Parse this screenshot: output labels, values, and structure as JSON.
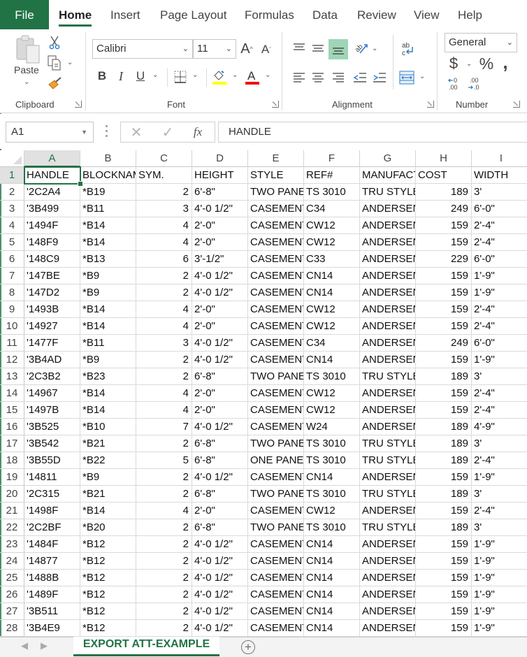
{
  "app": {
    "accent_color": "#217346"
  },
  "ribbon_tabs": [
    {
      "label": "File"
    },
    {
      "label": "Home"
    },
    {
      "label": "Insert"
    },
    {
      "label": "Page Layout"
    },
    {
      "label": "Formulas"
    },
    {
      "label": "Data"
    },
    {
      "label": "Review"
    },
    {
      "label": "View"
    },
    {
      "label": "Help"
    }
  ],
  "ribbon": {
    "clipboard": {
      "label": "Clipboard",
      "paste_label": "Paste"
    },
    "font": {
      "label": "Font",
      "font_name": "Calibri",
      "font_size": "11",
      "bold": "B",
      "italic": "I",
      "underline": "U",
      "fill_color": "#ffff00",
      "font_color": "#ff0000"
    },
    "alignment": {
      "label": "Alignment"
    },
    "number": {
      "label": "Number",
      "format": "General",
      "currency_symbol": "$",
      "percent_symbol": "%",
      "comma_symbol": ","
    }
  },
  "formula_bar": {
    "name_box": "A1",
    "fx_label": "fx",
    "content": "HANDLE"
  },
  "sheet": {
    "columns": [
      "A",
      "B",
      "C",
      "D",
      "E",
      "F",
      "G",
      "H",
      "I"
    ],
    "active_cell": "A1",
    "rows": [
      {
        "n": "1",
        "cells": [
          "HANDLE",
          "BLOCKNAME",
          "SYM.",
          "HEIGHT",
          "STYLE",
          "REF#",
          "MANUFACTURER",
          "COST",
          "WIDTH"
        ]
      },
      {
        "n": "2",
        "cells": [
          "'2C2A4",
          "*B19",
          "2",
          "6'-8\"",
          "TWO PANEL",
          "TS 3010",
          "TRU STYLE",
          "189",
          "3'"
        ]
      },
      {
        "n": "3",
        "cells": [
          "'3B499",
          "*B11",
          "3",
          "4'-0 1/2\"",
          "CASEMENT",
          "C34",
          "ANDERSEN",
          "249",
          "6'-0\""
        ]
      },
      {
        "n": "4",
        "cells": [
          "'1494F",
          "*B14",
          "4",
          "2'-0\"",
          "CASEMENT",
          "CW12",
          "ANDERSEN",
          "159",
          "2'-4\""
        ]
      },
      {
        "n": "5",
        "cells": [
          "'148F9",
          "*B14",
          "4",
          "2'-0\"",
          "CASEMENT",
          "CW12",
          "ANDERSEN",
          "159",
          "2'-4\""
        ]
      },
      {
        "n": "6",
        "cells": [
          "'148C9",
          "*B13",
          "6",
          "3'-1/2\"",
          "CASEMENT",
          "C33",
          "ANDERSEN",
          "229",
          "6'-0\""
        ]
      },
      {
        "n": "7",
        "cells": [
          "'147BE",
          "*B9",
          "2",
          "4'-0 1/2\"",
          "CASEMENT",
          "CN14",
          "ANDERSEN",
          "159",
          "1'-9\""
        ]
      },
      {
        "n": "8",
        "cells": [
          "'147D2",
          "*B9",
          "2",
          "4'-0 1/2\"",
          "CASEMENT",
          "CN14",
          "ANDERSEN",
          "159",
          "1'-9\""
        ]
      },
      {
        "n": "9",
        "cells": [
          "'1493B",
          "*B14",
          "4",
          "2'-0\"",
          "CASEMENT",
          "CW12",
          "ANDERSEN",
          "159",
          "2'-4\""
        ]
      },
      {
        "n": "10",
        "cells": [
          "'14927",
          "*B14",
          "4",
          "2'-0\"",
          "CASEMENT",
          "CW12",
          "ANDERSEN",
          "159",
          "2'-4\""
        ]
      },
      {
        "n": "11",
        "cells": [
          "'1477F",
          "*B11",
          "3",
          "4'-0 1/2\"",
          "CASEMENT",
          "C34",
          "ANDERSEN",
          "249",
          "6'-0\""
        ]
      },
      {
        "n": "12",
        "cells": [
          "'3B4AD",
          "*B9",
          "2",
          "4'-0 1/2\"",
          "CASEMENT",
          "CN14",
          "ANDERSEN",
          "159",
          "1'-9\""
        ]
      },
      {
        "n": "13",
        "cells": [
          "'2C3B2",
          "*B23",
          "2",
          "6'-8\"",
          "TWO PANEL",
          "TS 3010",
          "TRU STYLE",
          "189",
          "3'"
        ]
      },
      {
        "n": "14",
        "cells": [
          "'14967",
          "*B14",
          "4",
          "2'-0\"",
          "CASEMENT",
          "CW12",
          "ANDERSEN",
          "159",
          "2'-4\""
        ]
      },
      {
        "n": "15",
        "cells": [
          "'1497B",
          "*B14",
          "4",
          "2'-0\"",
          "CASEMENT",
          "CW12",
          "ANDERSEN",
          "159",
          "2'-4\""
        ]
      },
      {
        "n": "16",
        "cells": [
          "'3B525",
          "*B10",
          "7",
          "4'-0 1/2\"",
          "CASEMENT",
          "W24",
          "ANDERSEN",
          "189",
          "4'-9\""
        ]
      },
      {
        "n": "17",
        "cells": [
          "'3B542",
          "*B21",
          "2",
          "6'-8\"",
          "TWO PANEL",
          "TS 3010",
          "TRU STYLE",
          "189",
          "3'"
        ]
      },
      {
        "n": "18",
        "cells": [
          "'3B55D",
          "*B22",
          "5",
          "6'-8\"",
          "ONE PANEL",
          "TS 3010",
          "TRU STYLE",
          "189",
          "2'-4\""
        ]
      },
      {
        "n": "19",
        "cells": [
          "'14811",
          "*B9",
          "2",
          "4'-0 1/2\"",
          "CASEMENT",
          "CN14",
          "ANDERSEN",
          "159",
          "1'-9\""
        ]
      },
      {
        "n": "20",
        "cells": [
          "'2C315",
          "*B21",
          "2",
          "6'-8\"",
          "TWO PANEL",
          "TS 3010",
          "TRU STYLE",
          "189",
          "3'"
        ]
      },
      {
        "n": "21",
        "cells": [
          "'1498F",
          "*B14",
          "4",
          "2'-0\"",
          "CASEMENT",
          "CW12",
          "ANDERSEN",
          "159",
          "2'-4\""
        ]
      },
      {
        "n": "22",
        "cells": [
          "'2C2BF",
          "*B20",
          "2",
          "6'-8\"",
          "TWO PANEL",
          "TS 3010",
          "TRU STYLE",
          "189",
          "3'"
        ]
      },
      {
        "n": "23",
        "cells": [
          "'1484F",
          "*B12",
          "2",
          "4'-0 1/2\"",
          "CASEMENT",
          "CN14",
          "ANDERSEN",
          "159",
          "1'-9\""
        ]
      },
      {
        "n": "24",
        "cells": [
          "'14877",
          "*B12",
          "2",
          "4'-0 1/2\"",
          "CASEMENT",
          "CN14",
          "ANDERSEN",
          "159",
          "1'-9\""
        ]
      },
      {
        "n": "25",
        "cells": [
          "'1488B",
          "*B12",
          "2",
          "4'-0 1/2\"",
          "CASEMENT",
          "CN14",
          "ANDERSEN",
          "159",
          "1'-9\""
        ]
      },
      {
        "n": "26",
        "cells": [
          "'1489F",
          "*B12",
          "2",
          "4'-0 1/2\"",
          "CASEMENT",
          "CN14",
          "ANDERSEN",
          "159",
          "1'-9\""
        ]
      },
      {
        "n": "27",
        "cells": [
          "'3B511",
          "*B12",
          "2",
          "4'-0 1/2\"",
          "CASEMENT",
          "CN14",
          "ANDERSEN",
          "159",
          "1'-9\""
        ]
      },
      {
        "n": "28",
        "cells": [
          "'3B4E9",
          "*B12",
          "2",
          "4'-0 1/2\"",
          "CASEMENT",
          "CN14",
          "ANDERSEN",
          "159",
          "1'-9\""
        ]
      }
    ]
  },
  "sheet_tabs": [
    {
      "label": "EXPORT ATT-EXAMPLE",
      "active": true
    }
  ]
}
